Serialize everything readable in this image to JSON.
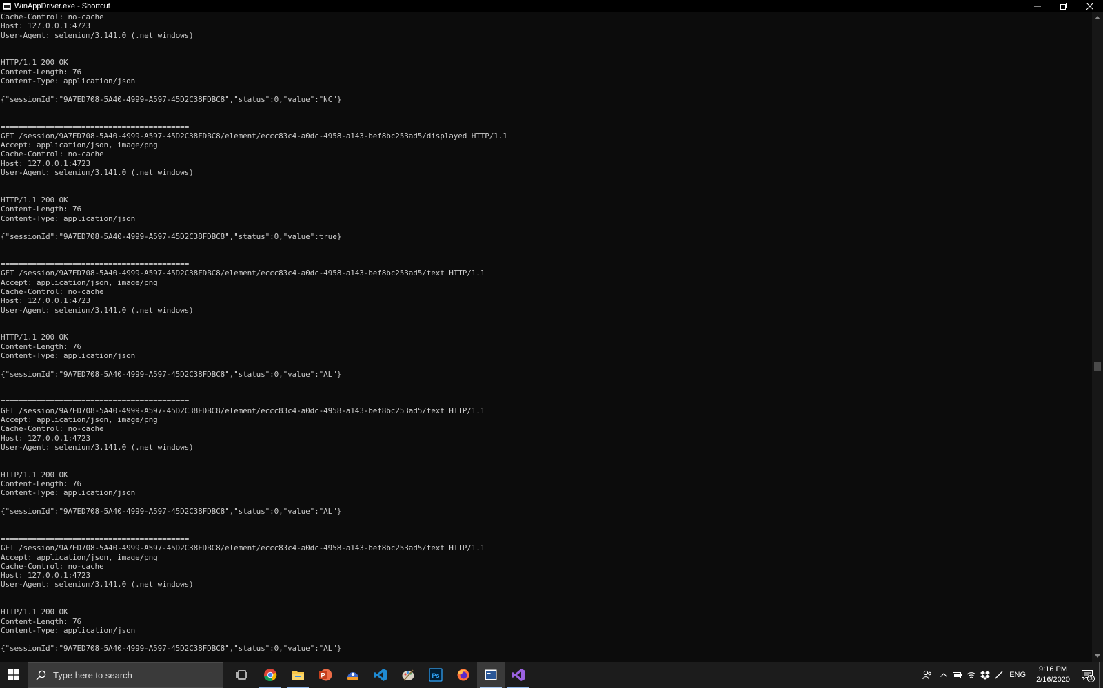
{
  "window": {
    "title": "WinAppDriver.exe - Shortcut"
  },
  "console": {
    "lines": [
      "Cache-Control: no-cache",
      "Host: 127.0.0.1:4723",
      "User-Agent: selenium/3.141.0 (.net windows)",
      "",
      "",
      "HTTP/1.1 200 OK",
      "Content-Length: 76",
      "Content-Type: application/json",
      "",
      "{\"sessionId\":\"9A7ED708-5A40-4999-A597-45D2C38FDBC8\",\"status\":0,\"value\":\"NC\"}",
      "",
      "",
      "==========================================",
      "GET /session/9A7ED708-5A40-4999-A597-45D2C38FDBC8/element/eccc83c4-a0dc-4958-a143-bef8bc253ad5/displayed HTTP/1.1",
      "Accept: application/json, image/png",
      "Cache-Control: no-cache",
      "Host: 127.0.0.1:4723",
      "User-Agent: selenium/3.141.0 (.net windows)",
      "",
      "",
      "HTTP/1.1 200 OK",
      "Content-Length: 76",
      "Content-Type: application/json",
      "",
      "{\"sessionId\":\"9A7ED708-5A40-4999-A597-45D2C38FDBC8\",\"status\":0,\"value\":true}",
      "",
      "",
      "==========================================",
      "GET /session/9A7ED708-5A40-4999-A597-45D2C38FDBC8/element/eccc83c4-a0dc-4958-a143-bef8bc253ad5/text HTTP/1.1",
      "Accept: application/json, image/png",
      "Cache-Control: no-cache",
      "Host: 127.0.0.1:4723",
      "User-Agent: selenium/3.141.0 (.net windows)",
      "",
      "",
      "HTTP/1.1 200 OK",
      "Content-Length: 76",
      "Content-Type: application/json",
      "",
      "{\"sessionId\":\"9A7ED708-5A40-4999-A597-45D2C38FDBC8\",\"status\":0,\"value\":\"AL\"}",
      "",
      "",
      "==========================================",
      "GET /session/9A7ED708-5A40-4999-A597-45D2C38FDBC8/element/eccc83c4-a0dc-4958-a143-bef8bc253ad5/text HTTP/1.1",
      "Accept: application/json, image/png",
      "Cache-Control: no-cache",
      "Host: 127.0.0.1:4723",
      "User-Agent: selenium/3.141.0 (.net windows)",
      "",
      "",
      "HTTP/1.1 200 OK",
      "Content-Length: 76",
      "Content-Type: application/json",
      "",
      "{\"sessionId\":\"9A7ED708-5A40-4999-A597-45D2C38FDBC8\",\"status\":0,\"value\":\"AL\"}",
      "",
      "",
      "==========================================",
      "GET /session/9A7ED708-5A40-4999-A597-45D2C38FDBC8/element/eccc83c4-a0dc-4958-a143-bef8bc253ad5/text HTTP/1.1",
      "Accept: application/json, image/png",
      "Cache-Control: no-cache",
      "Host: 127.0.0.1:4723",
      "User-Agent: selenium/3.141.0 (.net windows)",
      "",
      "",
      "HTTP/1.1 200 OK",
      "Content-Length: 76",
      "Content-Type: application/json",
      "",
      "{\"sessionId\":\"9A7ED708-5A40-4999-A597-45D2C38FDBC8\",\"status\":0,\"value\":\"AL\"}"
    ]
  },
  "taskbar": {
    "search_placeholder": "Type here to search",
    "apps": [
      {
        "name": "task-view-icon"
      },
      {
        "name": "chrome-icon"
      },
      {
        "name": "file-explorer-icon"
      },
      {
        "name": "powerpoint-icon"
      },
      {
        "name": "app-blue-orange-icon"
      },
      {
        "name": "vscode-icon"
      },
      {
        "name": "paint-icon"
      },
      {
        "name": "photoshop-icon"
      },
      {
        "name": "firefox-icon"
      },
      {
        "name": "console-window-icon"
      },
      {
        "name": "visual-studio-icon"
      }
    ],
    "tray": {
      "language": "ENG",
      "time": "9:16 PM",
      "date": "2/16/2020",
      "notification_count": "3"
    }
  },
  "colors": {
    "console_bg": "#0c0c0c",
    "console_text": "#cccccc",
    "taskbar_bg": "#1c1c1c",
    "active_indicator": "#a8c8f0"
  }
}
